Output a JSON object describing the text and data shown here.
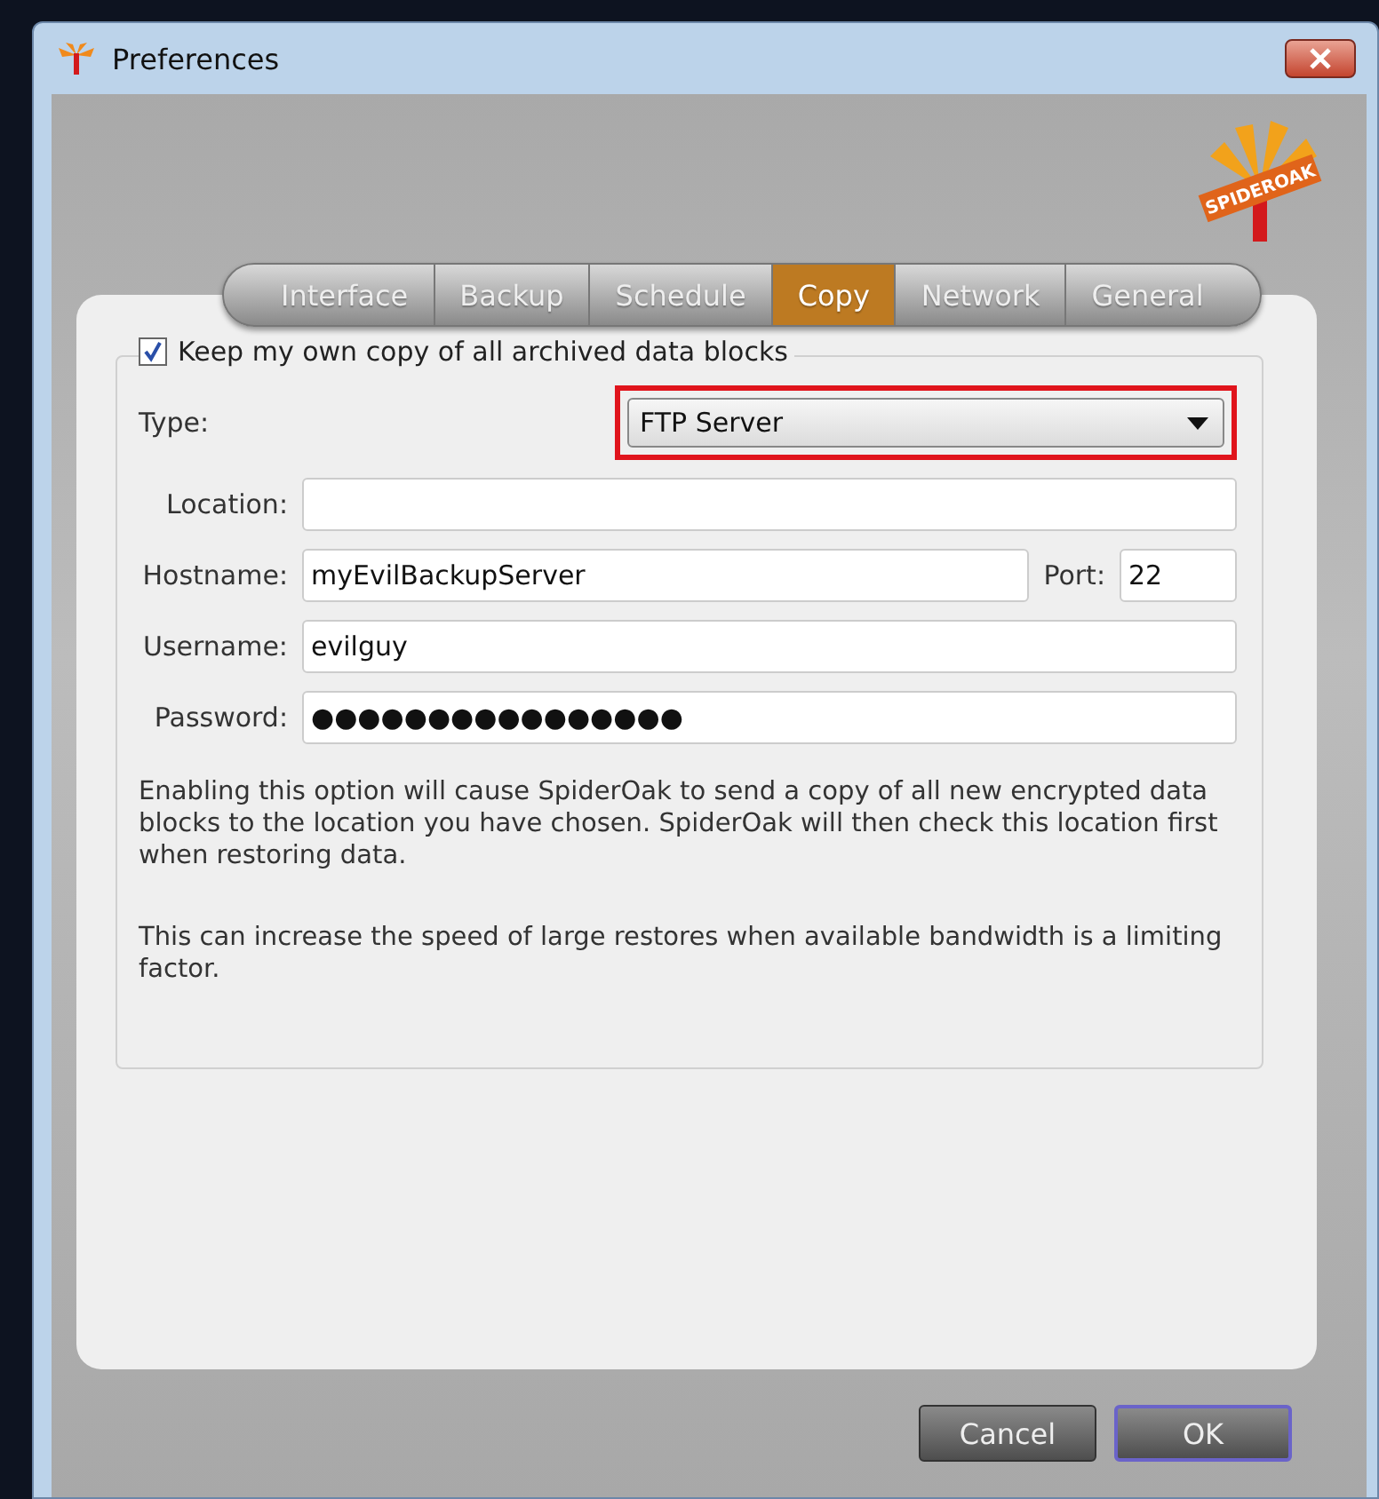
{
  "window": {
    "title": "Preferences",
    "logo_text": "SPIDEROAK"
  },
  "tabs": [
    {
      "label": "Interface",
      "selected": false
    },
    {
      "label": "Backup",
      "selected": false
    },
    {
      "label": "Schedule",
      "selected": false
    },
    {
      "label": "Copy",
      "selected": true
    },
    {
      "label": "Network",
      "selected": false
    },
    {
      "label": "General",
      "selected": false
    }
  ],
  "copy": {
    "checkbox": {
      "label": "Keep my own copy of all archived data blocks",
      "checked": true
    },
    "type": {
      "label": "Type:",
      "value": "FTP Server",
      "highlighted": true
    },
    "location": {
      "label": "Location:"
    },
    "hostname": {
      "label": "Hostname:",
      "value": "myEvilBackupServer"
    },
    "port": {
      "label": "Port:",
      "value": "22"
    },
    "username": {
      "label": "Username:",
      "value": "evilguy"
    },
    "password": {
      "label": "Password:",
      "value": "●●●●●●●●●●●●●●●●"
    },
    "notes": [
      "Enabling this option will cause SpiderOak to send a copy of all new encrypted data blocks to the location you have chosen.  SpiderOak will then check this location first when restoring data.",
      "This can increase the speed of large restores when available bandwidth is a limiting factor."
    ]
  },
  "buttons": [
    {
      "label": "Cancel",
      "default": false
    },
    {
      "label": "OK",
      "default": true
    }
  ]
}
